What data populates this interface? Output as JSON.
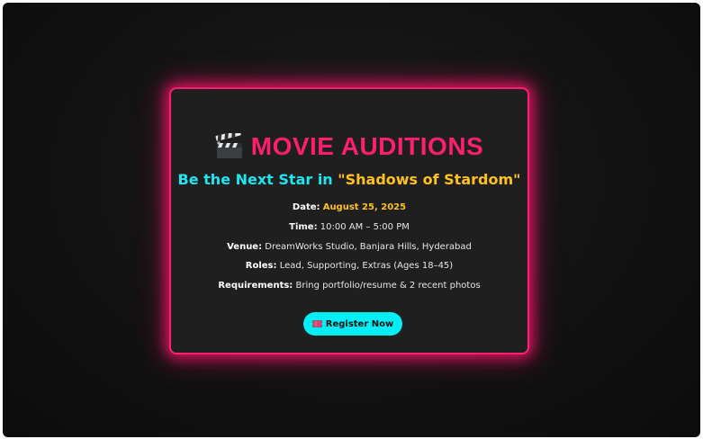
{
  "card": {
    "title": "MOVIE AUDITIONS",
    "icons": {
      "title_icon": "clapperboard-icon",
      "button_icon": "ticket-icon"
    },
    "subtitle_prefix": "Be the Next Star in ",
    "subtitle_highlight": "\"Shadows of Stardom\"",
    "date_label": "Date:",
    "date_value": "August 25, 2025",
    "time_label": "Time:",
    "time_value": " 10:00 AM – 5:00 PM",
    "venue_label": "Venue:",
    "venue_value": " DreamWorks Studio, Banjara Hills, Hyderabad",
    "roles_label": "Roles:",
    "roles_value": " Lead, Supporting, Extras (Ages 18–45)",
    "requirements_label": "Requirements:",
    "requirements_value": " Bring portfolio/resume & 2 recent photos",
    "register_label": "Register Now"
  },
  "colors": {
    "accent_pink": "#ff1f6e",
    "accent_cyan": "#1ee6f0",
    "accent_yellow": "#ffc21a",
    "card_bg": "#1f1f1f"
  }
}
